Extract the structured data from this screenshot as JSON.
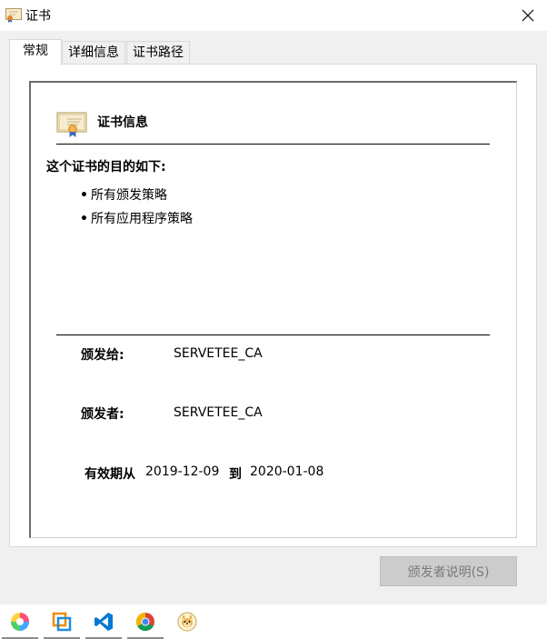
{
  "window": {
    "title": "证书"
  },
  "tabs": [
    {
      "label": "常规",
      "active": true
    },
    {
      "label": "详细信息",
      "active": false
    },
    {
      "label": "证书路径",
      "active": false
    }
  ],
  "general": {
    "header_title": "证书信息",
    "purpose_heading": "这个证书的目的如下:",
    "purposes": [
      "所有颁发策略",
      "所有应用程序策略"
    ],
    "issued_to_label": "颁发给:",
    "issued_to_value": "SERVETEE_CA",
    "issued_by_label": "颁发者:",
    "issued_by_value": "SERVETEE_CA",
    "validity_label": "有效期从",
    "valid_from": "2019-12-09",
    "valid_to_label": "到",
    "valid_to": "2020-01-08"
  },
  "buttons": {
    "issuer_statement": "颁发者说明(S)"
  },
  "taskbar": {
    "icons": [
      "colorful-pinwheel-icon",
      "vmware-icon",
      "vscode-icon",
      "chrome-icon",
      "doge-icon"
    ]
  },
  "colors": {
    "window_bg": "#f0f0f0",
    "disabled_button_bg": "#cccccc",
    "disabled_text": "#7a7a7a",
    "vscode_blue": "#0078d4"
  }
}
